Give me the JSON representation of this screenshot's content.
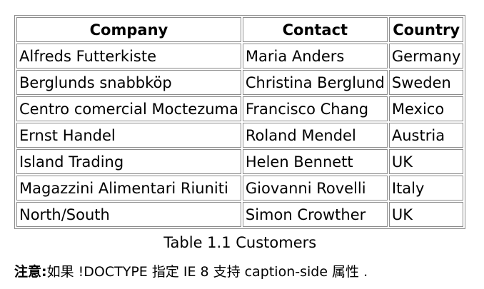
{
  "table": {
    "headers": [
      "Company",
      "Contact",
      "Country"
    ],
    "rows": [
      [
        "Alfreds Futterkiste",
        "Maria Anders",
        "Germany"
      ],
      [
        "Berglunds snabbköp",
        "Christina Berglund",
        "Sweden"
      ],
      [
        "Centro comercial Moctezuma",
        "Francisco Chang",
        "Mexico"
      ],
      [
        "Ernst Handel",
        "Roland Mendel",
        "Austria"
      ],
      [
        "Island Trading",
        "Helen Bennett",
        "UK"
      ],
      [
        "Magazzini Alimentari Riuniti",
        "Giovanni Rovelli",
        "Italy"
      ],
      [
        "North/South",
        "Simon Crowther",
        "UK"
      ]
    ],
    "caption": "Table 1.1 Customers"
  },
  "note": {
    "label": "注意:",
    "text": "如果 !DOCTYPE 指定 IE 8 支持 caption-side 属性 ."
  }
}
